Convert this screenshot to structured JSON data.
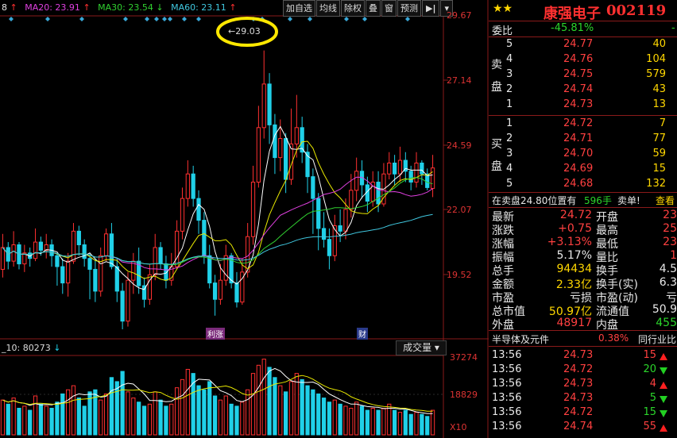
{
  "ma_line": {
    "prefix": "8",
    "ma20": "MA20: 23.91",
    "ma30": "MA30: 23.54",
    "ma60": "MA60: 23.11"
  },
  "toolbar": [
    "加自选",
    "均线",
    "除权",
    "叠",
    "窗",
    "预测"
  ],
  "price_axis": [
    "29.67",
    "27.14",
    "24.59",
    "22.07",
    "19.52"
  ],
  "peak_label": "←29.03",
  "event_marks": [
    "利涨",
    "财"
  ],
  "volume_header": {
    "text": "_10: 80273",
    "selector": "成交量"
  },
  "volume_axis": [
    "37274",
    "18829",
    "X10"
  ],
  "stock": {
    "name": "康强电子",
    "code": "002119",
    "stars": "★★"
  },
  "commission": {
    "label": "委比",
    "value": "-45.81%"
  },
  "sell_label": [
    "卖",
    "盘"
  ],
  "buy_label": [
    "买",
    "盘"
  ],
  "sell_orders": [
    {
      "level": "5",
      "price": "24.77",
      "volume": "40"
    },
    {
      "level": "4",
      "price": "24.76",
      "volume": "104"
    },
    {
      "level": "3",
      "price": "24.75",
      "volume": "579"
    },
    {
      "level": "2",
      "price": "24.74",
      "volume": "43"
    },
    {
      "level": "1",
      "price": "24.73",
      "volume": "13"
    }
  ],
  "buy_orders": [
    {
      "level": "1",
      "price": "24.72",
      "volume": "7"
    },
    {
      "level": "2",
      "price": "24.71",
      "volume": "77"
    },
    {
      "level": "3",
      "price": "24.70",
      "volume": "59"
    },
    {
      "level": "4",
      "price": "24.69",
      "volume": "15"
    },
    {
      "level": "5",
      "price": "24.68",
      "volume": "132"
    }
  ],
  "pending": {
    "text": "在卖盘24.80位置有",
    "amount": "596手",
    "action": "卖单!",
    "view": "查看"
  },
  "quote": [
    {
      "l1": "最新",
      "v1": "24.72",
      "l2": "开盘",
      "v2": "23"
    },
    {
      "l1": "涨跌",
      "v1": "+0.75",
      "l2": "最高",
      "v2": "25"
    },
    {
      "l1": "涨幅",
      "v1": "+3.13%",
      "l2": "最低",
      "v2": "23"
    },
    {
      "l1": "振幅",
      "v1": "5.17%",
      "l2": "量比",
      "v2": "1"
    },
    {
      "l1": "总手",
      "v1": "94434",
      "l2": "换手",
      "v2": "4.5"
    },
    {
      "l1": "金额",
      "v1": "2.33亿",
      "l2": "换手(实)",
      "v2": "6.3"
    },
    {
      "l1": "市盈",
      "v1": "亏损",
      "l2": "市盈(动)",
      "v2": "亏"
    },
    {
      "l1": "总市值",
      "v1": "50.97亿",
      "l2": "流通值",
      "v2": "50.9"
    },
    {
      "l1": "外盘",
      "v1": "48917",
      "l2": "内盘",
      "v2": "455"
    }
  ],
  "sector": {
    "name": "半导体及元件",
    "change": "0.38%",
    "compare": "同行业比"
  },
  "ticks": [
    {
      "time": "13:56",
      "price": "24.73",
      "vol": "15",
      "dir": "up"
    },
    {
      "time": "13:56",
      "price": "24.72",
      "vol": "20",
      "dir": "down"
    },
    {
      "time": "13:56",
      "price": "24.73",
      "vol": "4",
      "dir": "up"
    },
    {
      "time": "13:56",
      "price": "24.73",
      "vol": "5",
      "dir": "down"
    },
    {
      "time": "13:56",
      "price": "24.72",
      "vol": "15",
      "dir": "down"
    },
    {
      "time": "13:56",
      "price": "24.74",
      "vol": "55",
      "dir": "up"
    }
  ],
  "colors": {
    "up": "#ff3030",
    "down": "#20d0e8",
    "ma5": "#ffffff",
    "ma10": "#e8e800",
    "ma20": "#e040e0",
    "ma30": "#30d030",
    "ma60": "#40c8e0",
    "highlight": "#ffe800"
  },
  "chart_data": {
    "type": "candlestick",
    "ylim": [
      18.8,
      30.3
    ],
    "peak": 29.03,
    "candles": [
      [
        21.0,
        21.8,
        20.7,
        22.3
      ],
      [
        21.8,
        21.3,
        21.0,
        22.0
      ],
      [
        21.3,
        21.9,
        21.1,
        22.4
      ],
      [
        21.9,
        21.2,
        21.0,
        22.0
      ],
      [
        21.2,
        21.6,
        20.9,
        21.9
      ],
      [
        21.6,
        21.4,
        21.1,
        21.8
      ],
      [
        21.4,
        22.0,
        21.3,
        22.5
      ],
      [
        22.0,
        21.7,
        21.5,
        22.2
      ],
      [
        21.7,
        21.9,
        21.4,
        22.3
      ],
      [
        21.9,
        21.5,
        21.1,
        22.1
      ],
      [
        21.5,
        21.1,
        20.4,
        21.6
      ],
      [
        21.1,
        20.5,
        20.1,
        21.4
      ],
      [
        20.5,
        21.3,
        20.0,
        21.6
      ],
      [
        21.3,
        22.4,
        21.2,
        22.7
      ],
      [
        22.4,
        21.9,
        21.5,
        22.6
      ],
      [
        21.9,
        21.4,
        21.1,
        22.1
      ],
      [
        21.4,
        21.0,
        19.9,
        21.6
      ],
      [
        21.0,
        20.2,
        19.8,
        21.4
      ],
      [
        20.2,
        21.5,
        20.0,
        21.8
      ],
      [
        21.5,
        22.3,
        21.3,
        22.5
      ],
      [
        22.3,
        21.1,
        21.0,
        22.7
      ],
      [
        21.1,
        20.2,
        19.8,
        21.4
      ],
      [
        20.2,
        19.1,
        18.8,
        20.5
      ],
      [
        19.1,
        20.6,
        18.9,
        20.9
      ],
      [
        20.6,
        21.3,
        20.1,
        21.6
      ],
      [
        21.3,
        20.4,
        20.1,
        21.8
      ],
      [
        20.4,
        19.9,
        19.6,
        20.7
      ],
      [
        19.9,
        20.8,
        19.7,
        21.2
      ],
      [
        20.8,
        21.8,
        20.6,
        22.3
      ],
      [
        21.8,
        21.2,
        21.0,
        22.0
      ],
      [
        21.2,
        20.6,
        20.3,
        21.5
      ],
      [
        20.6,
        21.1,
        20.4,
        21.6
      ],
      [
        21.1,
        22.4,
        21.0,
        22.8
      ],
      [
        22.4,
        23.6,
        22.1,
        24.0
      ],
      [
        23.6,
        24.5,
        23.3,
        25.0
      ],
      [
        24.5,
        23.6,
        23.3,
        24.8
      ],
      [
        23.6,
        22.8,
        22.3,
        23.9
      ],
      [
        22.8,
        21.5,
        21.2,
        23.1
      ],
      [
        21.5,
        20.5,
        20.3,
        21.9
      ],
      [
        20.5,
        19.9,
        19.3,
        20.8
      ],
      [
        19.9,
        20.6,
        19.7,
        21.2
      ],
      [
        20.6,
        21.5,
        20.4,
        21.9
      ],
      [
        21.5,
        20.5,
        20.3,
        21.6
      ],
      [
        20.5,
        19.8,
        19.6,
        20.9
      ],
      [
        19.8,
        20.9,
        19.7,
        21.4
      ],
      [
        20.9,
        22.2,
        20.7,
        22.7
      ],
      [
        22.2,
        24.2,
        21.9,
        24.8
      ],
      [
        24.2,
        26.2,
        24.0,
        27.0
      ],
      [
        26.2,
        27.8,
        25.8,
        29.03
      ],
      [
        27.8,
        26.3,
        25.6,
        28.2
      ],
      [
        26.3,
        25.1,
        24.5,
        26.7
      ],
      [
        25.1,
        25.8,
        24.6,
        26.5
      ],
      [
        25.8,
        24.3,
        23.8,
        26.0
      ],
      [
        24.3,
        25.6,
        24.1,
        26.9
      ],
      [
        25.6,
        26.2,
        25.1,
        27.4
      ],
      [
        26.2,
        25.3,
        24.9,
        26.6
      ],
      [
        25.3,
        24.4,
        23.8,
        25.6
      ],
      [
        24.4,
        23.6,
        22.3,
        24.7
      ],
      [
        23.6,
        22.5,
        21.7,
        23.8
      ],
      [
        22.5,
        22.1,
        21.8,
        23.1
      ],
      [
        22.1,
        21.5,
        21.0,
        22.5
      ],
      [
        21.5,
        22.6,
        21.3,
        23.0
      ],
      [
        22.6,
        22.4,
        22.0,
        23.2
      ],
      [
        22.4,
        23.2,
        22.1,
        23.6
      ],
      [
        23.2,
        23.9,
        22.9,
        24.5
      ],
      [
        23.9,
        24.6,
        23.5,
        25.1
      ],
      [
        24.6,
        24.1,
        23.6,
        25.0
      ],
      [
        24.1,
        23.5,
        23.1,
        24.4
      ],
      [
        23.5,
        24.2,
        23.3,
        24.6
      ],
      [
        24.2,
        23.4,
        23.1,
        24.6
      ],
      [
        23.4,
        24.5,
        23.3,
        24.9
      ],
      [
        24.5,
        24.9,
        24.3,
        25.3
      ],
      [
        24.9,
        24.5,
        24.1,
        25.2
      ],
      [
        24.5,
        25.0,
        24.2,
        25.5
      ],
      [
        25.0,
        24.6,
        24.2,
        25.3
      ],
      [
        24.6,
        24.2,
        23.9,
        24.8
      ],
      [
        24.2,
        24.9,
        24.0,
        25.3
      ],
      [
        24.9,
        24.5,
        24.1,
        25.0
      ],
      [
        24.5,
        24.0,
        23.9,
        24.7
      ],
      [
        23.97,
        24.72,
        23.65,
        25.2
      ]
    ],
    "volumes": [
      17,
      15,
      18,
      13,
      14,
      12,
      19,
      15,
      14,
      13,
      16,
      20,
      22,
      24,
      18,
      14,
      21,
      22,
      17,
      20,
      28,
      26,
      31,
      21,
      18,
      16,
      14,
      15,
      21,
      17,
      14,
      15,
      23,
      27,
      32,
      30,
      24,
      22,
      26,
      19,
      17,
      19,
      15,
      14,
      16,
      22,
      30,
      34,
      37,
      33,
      28,
      24,
      21,
      26,
      30,
      27,
      24,
      22,
      20,
      18,
      16,
      17,
      15,
      14,
      13,
      16,
      14,
      12,
      13,
      12,
      13,
      15,
      12,
      11,
      12,
      10,
      11,
      10,
      9,
      12
    ]
  }
}
